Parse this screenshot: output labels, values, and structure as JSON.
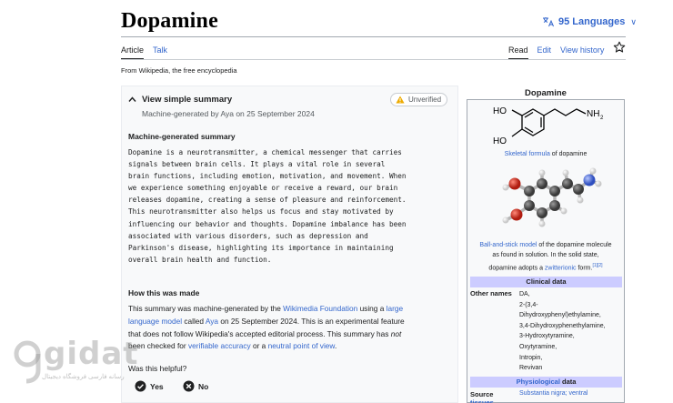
{
  "article": {
    "title": "Dopamine",
    "languages_label": "95 Languages",
    "tabs": [
      "Article",
      "Talk"
    ],
    "actions": [
      "Read",
      "Edit",
      "View history"
    ],
    "tagline": "From Wikipedia, the free encyclopedia"
  },
  "summary": {
    "toggle_label": "View simple summary",
    "meta": "Machine-generated by Aya on 25 September 2024",
    "badge": "Unverified",
    "heading": "Machine-generated summary",
    "text_lines": [
      "Dopamine is a neurotransmitter, a chemical messenger that carries",
      "signals between brain cells. It plays a vital role in several",
      "brain functions, including emotion, motivation, and movement. When",
      "we experience something enjoyable or receive a reward, our brain",
      "releases dopamine, creating a sense of pleasure and reinforcement.",
      "This neurotransmitter also helps us focus and stay motivated by",
      "influencing our behavior and thoughts. Dopamine imbalance has been",
      "associated with various disorders, such as depression and",
      "Parkinson's disease, highlighting its importance in maintaining",
      "overall brain health and function."
    ],
    "how_heading": "How this was made",
    "how": {
      "l1a": "This summary was machine-generated by the ",
      "l1_link": "Wikimedia Foundation",
      "l1b": " using a ",
      "l1_link2": "large",
      "l2_link": "language model",
      "l2a": " called ",
      "l2_link2": "Aya",
      "l2b": " on 25 September 2024. This is an experimental feature",
      "l3": "that does not follow Wikipedia's accepted editorial process. This summary has ",
      "l3_em": "not",
      "l4a": "been checked for ",
      "l4_link": "verifiable accuracy",
      "l4b": " or a ",
      "l4_link2": "neutral point of view",
      "l4c": "."
    },
    "helpful_question": "Was this helpful?",
    "yes_label": "Yes",
    "no_label": "No"
  },
  "infobox": {
    "title": "Dopamine",
    "skeletal_caption_link": "Skeletal formula",
    "skeletal_caption_rest": " of dopamine",
    "chem_ho": "HO",
    "chem_nh2": "NH",
    "chem_sub2": "2",
    "ball_caption_link": "Ball-and-stick model",
    "ball_caption_l1": " of the dopamine molecule",
    "ball_caption_l2": "as found in solution. In the solid state,",
    "ball_caption_l3a": "dopamine adopts a ",
    "ball_caption_l3_link": "zwitterionic",
    "ball_caption_l3b": " form.",
    "ball_caption_refs": "[1][2]",
    "clinical_header": "Clinical data",
    "other_names_label": "Other names",
    "other_names": [
      "DA,",
      "2-(3,4-",
      "Dihydroxyphenyl)ethylamine,",
      "3,4-Dihydroxyphenethylamine,",
      "3-Hydroxytyramine,",
      "Oxytyramine,",
      "Intropin,",
      "Revivan"
    ],
    "physio_header_link": "Physiological",
    "physio_header_rest": " data",
    "source_label_l1": "Source",
    "source_label_l2": "tissues",
    "source_value": "Substantia nigra; ventral"
  },
  "watermark": {
    "brand": "gidat",
    "sub": "رسانه فارسی فروشگاه دیجیتال"
  },
  "colors": {
    "link": "#3366cc",
    "band": "#ccccff",
    "badge_warning": "#edab00"
  }
}
